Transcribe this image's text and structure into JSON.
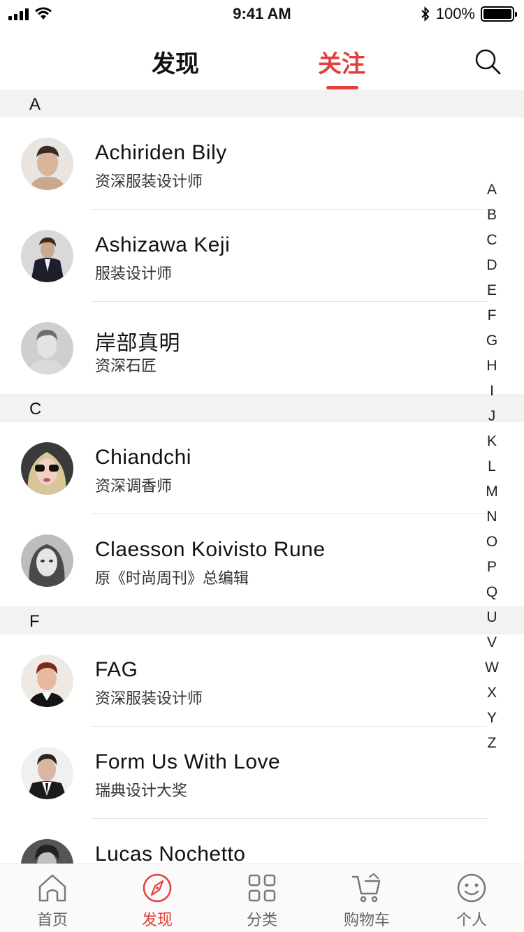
{
  "status_bar": {
    "time": "9:41 AM",
    "battery": "100%"
  },
  "nav": {
    "tabs": [
      {
        "label": "发现"
      },
      {
        "label": "关注"
      }
    ],
    "active_tab": "关注",
    "accent_color": "#e2403c"
  },
  "sections": [
    {
      "letter": "A",
      "items": [
        {
          "name": "Achiriden Bily",
          "subtitle": "资深服装设计师"
        },
        {
          "name": "Ashizawa Keji",
          "subtitle": "服装设计师"
        },
        {
          "name": "岸部真明",
          "subtitle": "资深石匠"
        }
      ]
    },
    {
      "letter": "C",
      "items": [
        {
          "name": "Chiandchi",
          "subtitle": "资深调香师"
        },
        {
          "name": "Claesson Koivisto Rune",
          "subtitle": "原《时尚周刊》总编辑"
        }
      ]
    },
    {
      "letter": "F",
      "items": [
        {
          "name": "FAG",
          "subtitle": "资深服装设计师"
        },
        {
          "name": "Form Us With Love",
          "subtitle": "瑞典设计大奖"
        }
      ]
    }
  ],
  "partial_item": {
    "name": "Lucas Nochetto"
  },
  "alphabet": [
    "A",
    "B",
    "C",
    "D",
    "E",
    "F",
    "G",
    "H",
    "I",
    "J",
    "K",
    "L",
    "M",
    "N",
    "O",
    "P",
    "Q",
    "U",
    "V",
    "W",
    "X",
    "Y",
    "Z"
  ],
  "tab_bar": {
    "items": [
      {
        "label": "首页",
        "icon": "home-icon"
      },
      {
        "label": "发现",
        "icon": "compass-icon"
      },
      {
        "label": "分类",
        "icon": "category-grid-icon"
      },
      {
        "label": "购物车",
        "icon": "cart-icon"
      },
      {
        "label": "个人",
        "icon": "smiley-icon"
      }
    ],
    "active_index": 1
  }
}
